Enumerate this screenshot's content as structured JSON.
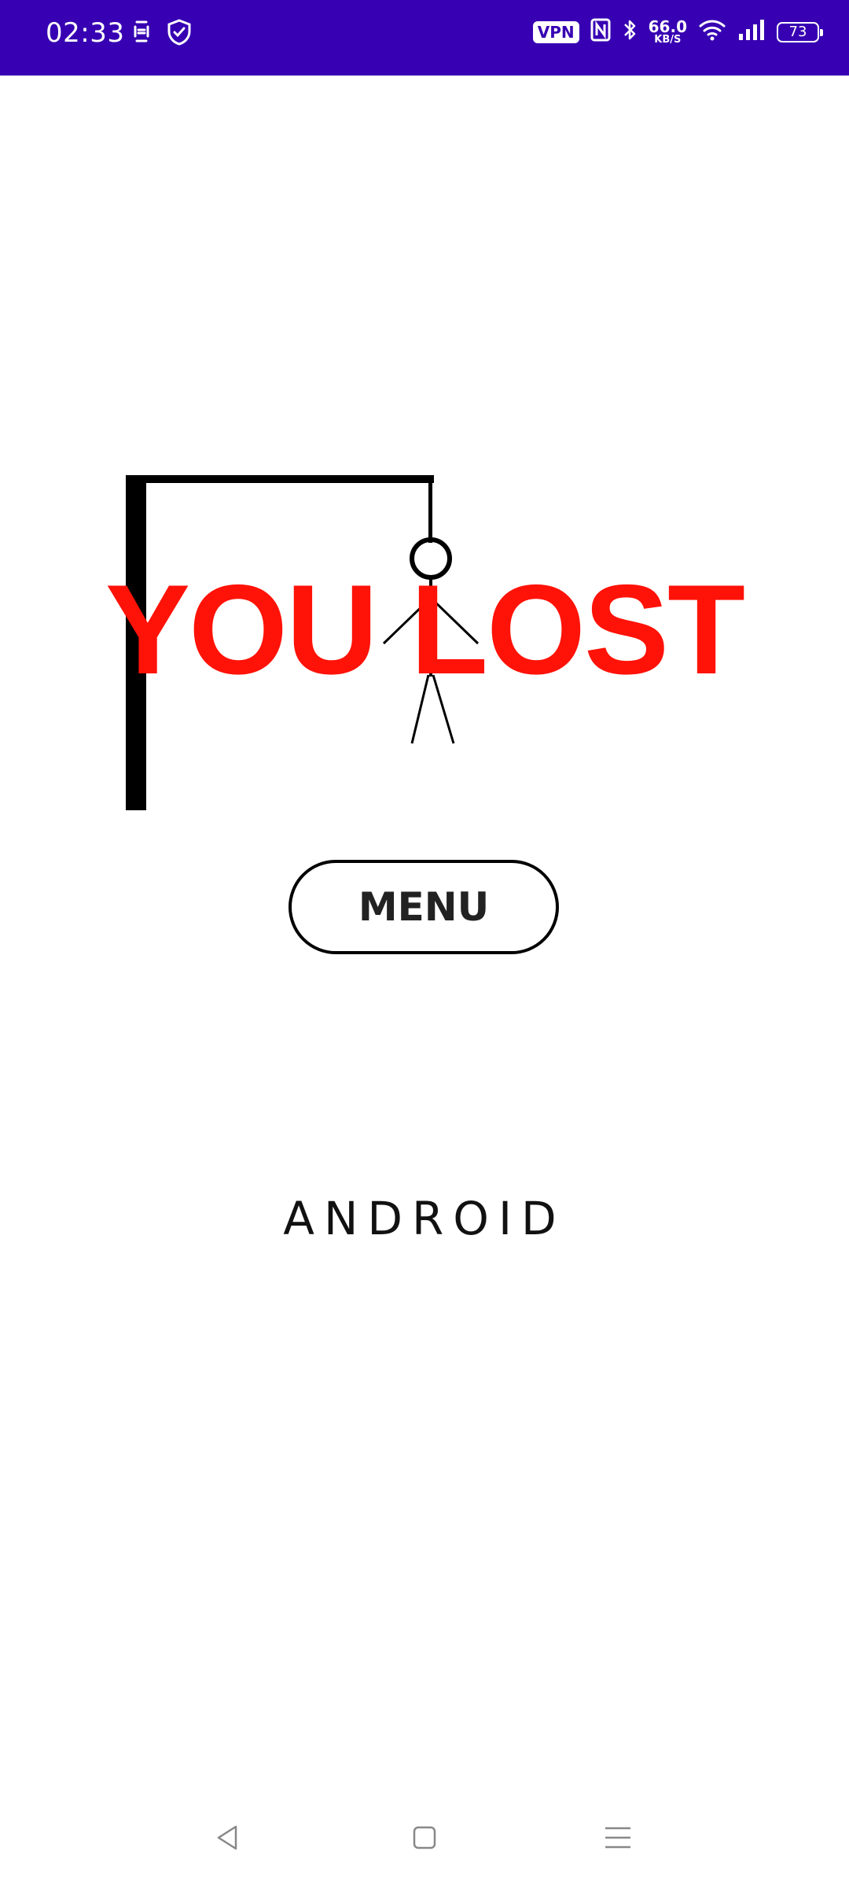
{
  "status_bar": {
    "time": "02:33",
    "vpn_label": "VPN",
    "speed_value": "66.0",
    "speed_unit": "KB/S",
    "battery_level": "73",
    "icons": [
      "face-id-icon",
      "shield-check-icon",
      "vpn-icon",
      "nfc-icon",
      "bluetooth-icon",
      "wifi-icon",
      "signal-icon",
      "battery-icon"
    ]
  },
  "game": {
    "result_text": "YOU LOST",
    "menu_button_label": "MENU",
    "platform_label": "ANDROID"
  },
  "colors": {
    "status_bar": "#3700b3",
    "result_text": "#ff1207",
    "background": "#ffffff"
  },
  "nav_bar": {
    "icons": [
      "back-icon",
      "home-icon",
      "recents-icon"
    ]
  }
}
